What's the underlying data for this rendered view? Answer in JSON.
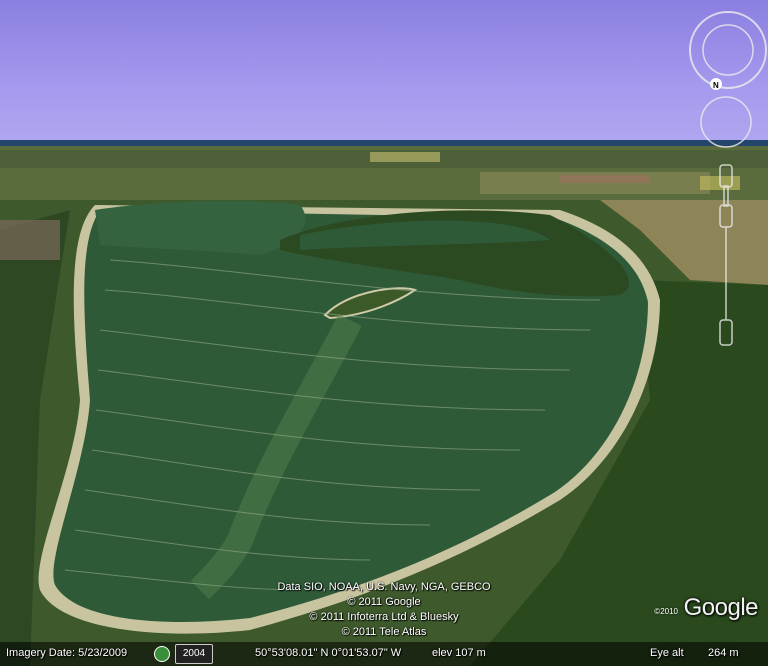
{
  "attribution": {
    "line1": "Data SIO, NOAA, U.S. Navy, NGA, GEBCO",
    "line2": "© 2011 Google",
    "line3": "© 2011 Infoterra Ltd & Bluesky",
    "line4": "© 2011 Tele Atlas"
  },
  "logo": {
    "text": "Google",
    "year": "©2010"
  },
  "status": {
    "imagery_date": "Imagery Date: 5/23/2009",
    "year_badge": "2004",
    "coords": "50°53'08.01\" N    0°01'53.07\" W",
    "elev": "elev  107 m",
    "eye_alt_label": "Eye alt",
    "eye_alt_value": "264 m"
  },
  "nav": {
    "north_label": "N"
  },
  "colors": {
    "sky": "#a49aee",
    "field": "#2f5a38",
    "forest": "#2c4a22",
    "sea": "#1e3f66"
  }
}
